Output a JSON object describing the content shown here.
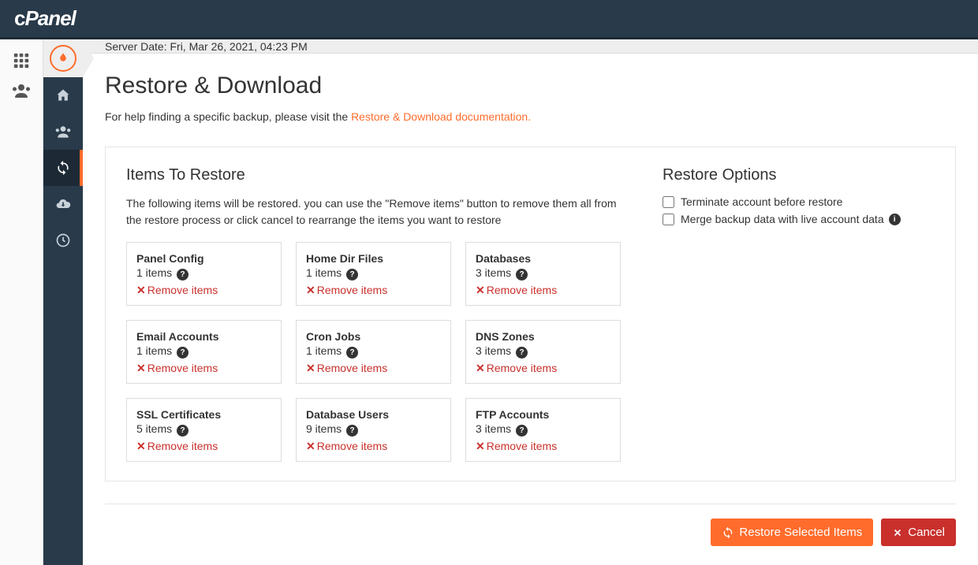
{
  "brand": "cPanel",
  "server_date": "Server Date: Fri, Mar 26, 2021, 04:23 PM",
  "page_title": "Restore & Download",
  "help_prefix": "For help finding a specific backup, please visit the ",
  "help_link": "Restore & Download documentation.",
  "items_heading": "Items To Restore",
  "items_desc": "The following items will be restored. you can use the \"Remove items\" button to remove them all from the restore process or click cancel to rearrange the items you want to restore",
  "remove_label": "Remove items",
  "options_heading": "Restore Options",
  "opt_terminate": "Terminate account before restore",
  "opt_merge": "Merge backup data with live account data",
  "btn_restore": "Restore Selected Items",
  "btn_cancel": "Cancel",
  "cards": [
    {
      "title": "Panel Config",
      "count": "1 items"
    },
    {
      "title": "Home Dir Files",
      "count": "1 items"
    },
    {
      "title": "Databases",
      "count": "3 items"
    },
    {
      "title": "Email Accounts",
      "count": "1 items"
    },
    {
      "title": "Cron Jobs",
      "count": "1 items"
    },
    {
      "title": "DNS Zones",
      "count": "3 items"
    },
    {
      "title": "SSL Certificates",
      "count": "5 items"
    },
    {
      "title": "Database Users",
      "count": "9 items"
    },
    {
      "title": "FTP Accounts",
      "count": "3 items"
    }
  ]
}
